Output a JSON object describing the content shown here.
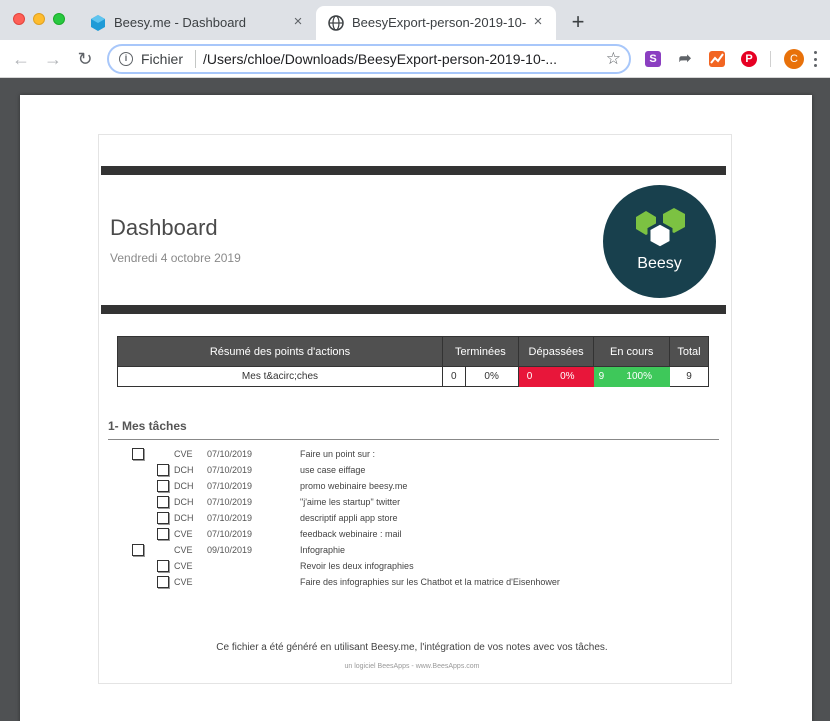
{
  "tabs": [
    {
      "title": "Beesy.me - Dashboard",
      "close": "×"
    },
    {
      "title": "BeesyExport-person-2019-10-",
      "close": "×"
    }
  ],
  "new_tab": "+",
  "toolbar": {
    "scheme_label": "Fichier",
    "url": "/Users/chloe/Downloads/BeesyExport-person-2019-10-...",
    "avatar_initial": "C",
    "ext_s_label": "S"
  },
  "document": {
    "title": "Dashboard",
    "date": "Vendredi 4 octobre 2019",
    "logo_text": "Beesy",
    "summary": {
      "headers": [
        "Résumé des points d'actions",
        "Terminées",
        "Dépassées",
        "En cours",
        "Total"
      ],
      "row": {
        "label": "Mes t&acirc;ches",
        "done_count": "0",
        "done_pct": "0%",
        "overdue_count": "0",
        "overdue_pct": "0%",
        "current_count": "9",
        "current_pct": "100%",
        "total": "9"
      }
    },
    "section_title": "1- Mes tâches",
    "tasks": [
      {
        "owner": "CVE",
        "date": "07/10/2019",
        "label": "Faire un point sur :"
      },
      {
        "owner": "DCH",
        "date": "07/10/2019",
        "label": "use case eiffage"
      },
      {
        "owner": "DCH",
        "date": "07/10/2019",
        "label": "promo webinaire beesy.me"
      },
      {
        "owner": "DCH",
        "date": "07/10/2019",
        "label": "\"j'aime les startup\" twitter"
      },
      {
        "owner": "DCH",
        "date": "07/10/2019",
        "label": "descriptif appli app store"
      },
      {
        "owner": "CVE",
        "date": "07/10/2019",
        "label": "feedback webinaire : mail"
      },
      {
        "owner": "CVE",
        "date": "09/10/2019",
        "label": "Infographie"
      },
      {
        "owner": "CVE",
        "date": "",
        "label": "Revoir les deux infographies"
      },
      {
        "owner": "CVE",
        "date": "",
        "label": "Faire des infographies sur les Chatbot et la matrice d'Eisenhower"
      }
    ],
    "footer": "Ce fichier a été généré en utilisant Beesy.me, l'intégration de vos notes avec vos tâches.",
    "footer_small": "un logiciel BeesApps - www.BeesApps.com"
  },
  "colors": {
    "overdue": "#e8163a",
    "in_progress": "#3ec85a",
    "header_bar": "#333333",
    "logo_bg": "#18404d",
    "logo_hex": "#7cc242"
  }
}
